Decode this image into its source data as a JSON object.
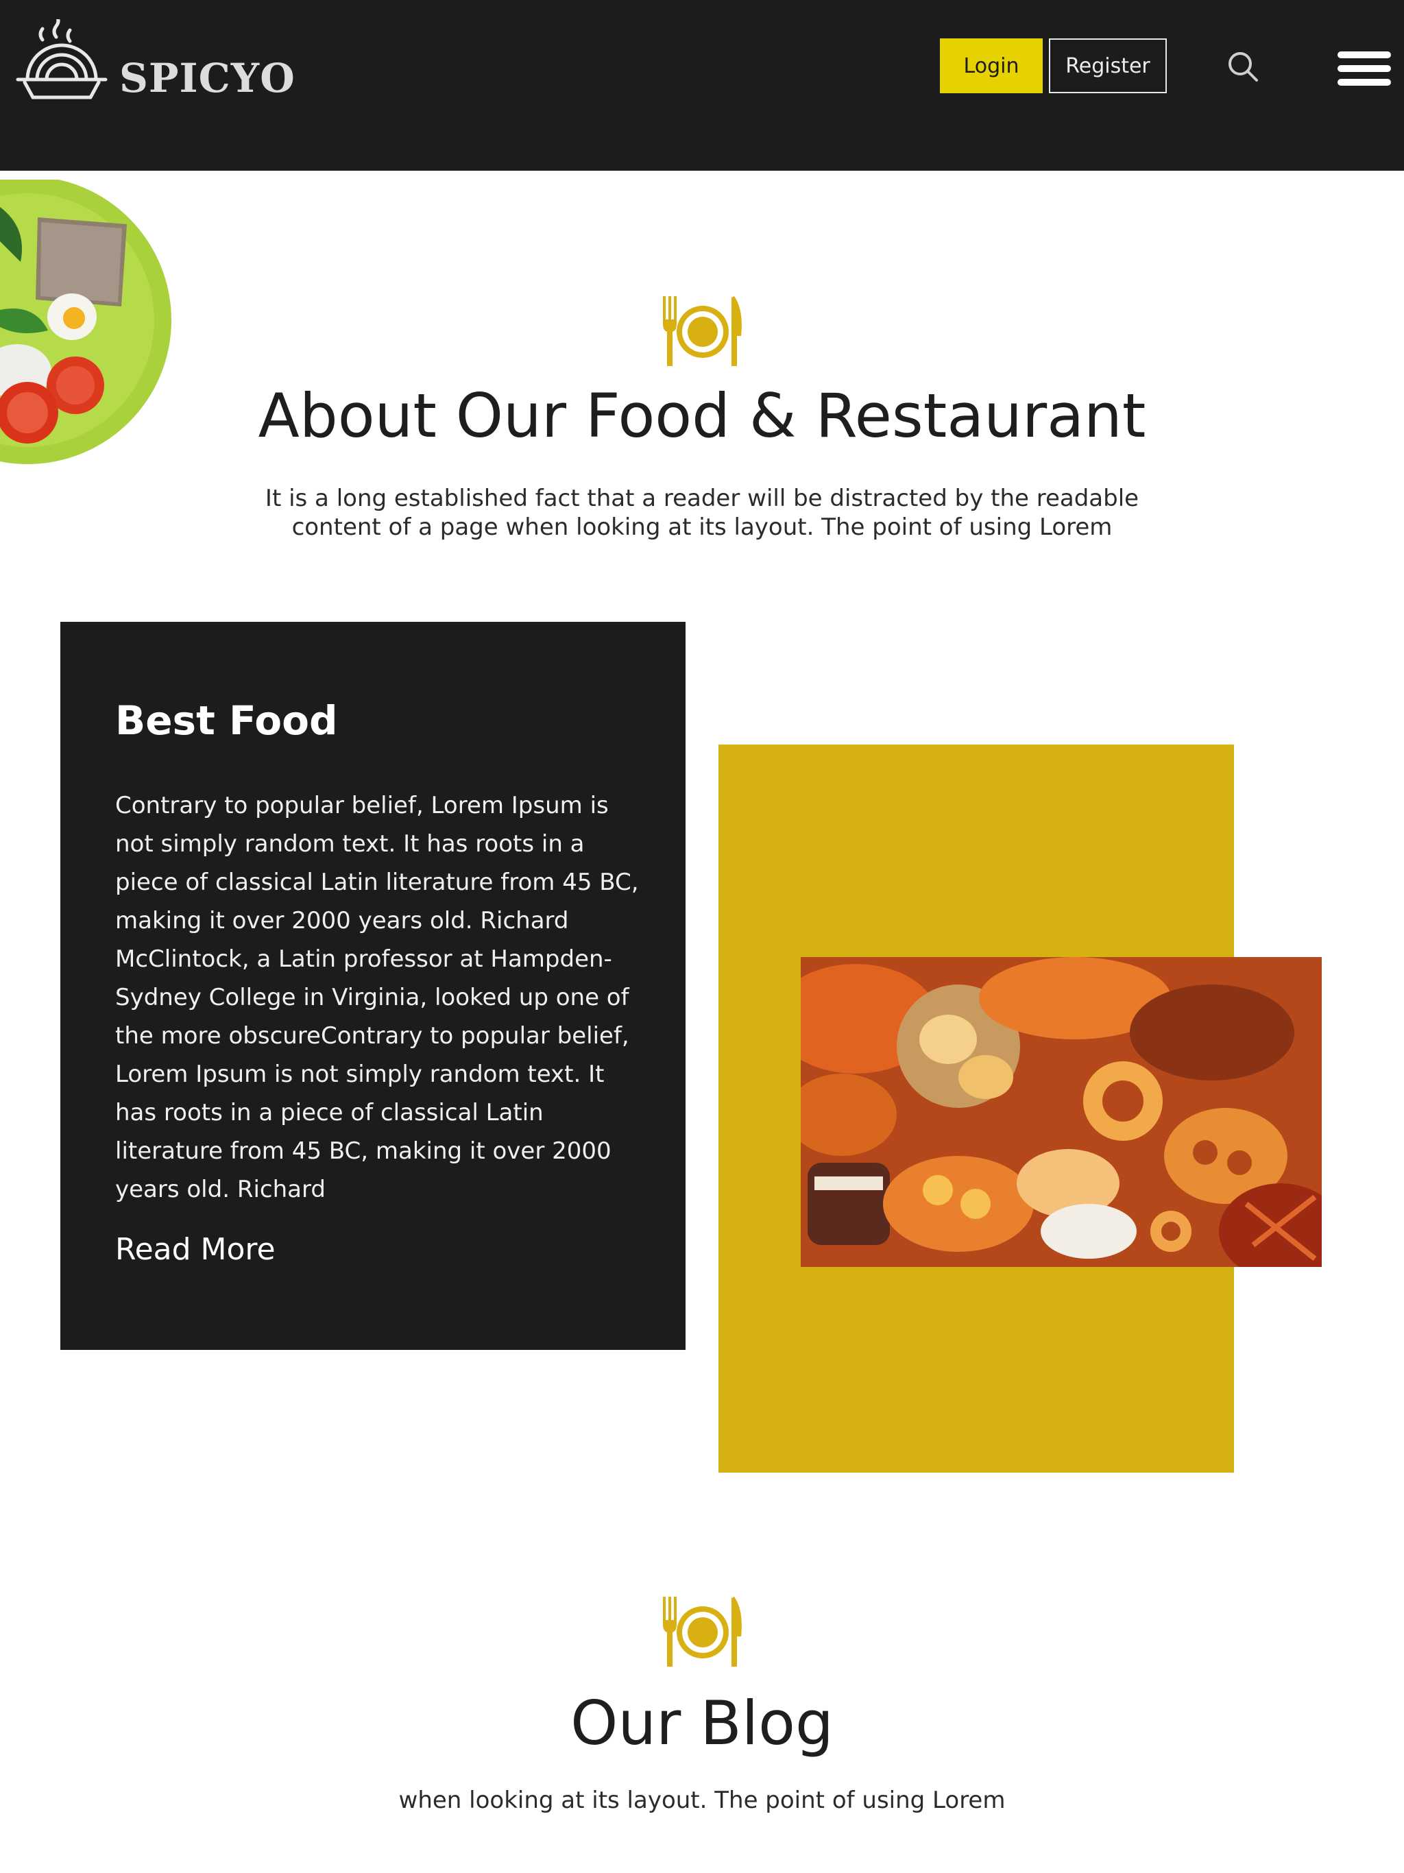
{
  "header": {
    "brand": "SPICYO",
    "login_label": "Login",
    "register_label": "Register",
    "icons": [
      "noodle-bowl-logo-icon",
      "search-icon",
      "hamburger-menu-icon"
    ]
  },
  "about": {
    "icon": "fork-plate-knife-icon",
    "title": "About Our Food & Restaurant",
    "text": "It is a long established fact that a reader will be distracted by the readable content of a page when looking at its layout. The point of using Lorem"
  },
  "feature": {
    "title": "Best Food",
    "body": "Contrary to popular belief, Lorem Ipsum is not simply random text. It has roots in a piece of classical Latin literature from 45 BC, making it over 2000 years old. Richard McClintock, a Latin professor at Hampden-Sydney College in Virginia, looked up one of the more obscureContrary to popular belief, Lorem Ipsum is not simply random text. It has roots in a piece of classical Latin literature from 45 BC, making it over 2000 years old. Richard",
    "read_more": "Read More"
  },
  "blog": {
    "icon": "fork-plate-knife-icon",
    "title": "Our Blog",
    "text": "when looking at its layout. The point of using Lorem"
  },
  "colors": {
    "header_bg": "#1c1c1c",
    "accent_yellow": "#e6d200",
    "block_gold": "#d5b112",
    "icon_gold": "#d9b011"
  }
}
